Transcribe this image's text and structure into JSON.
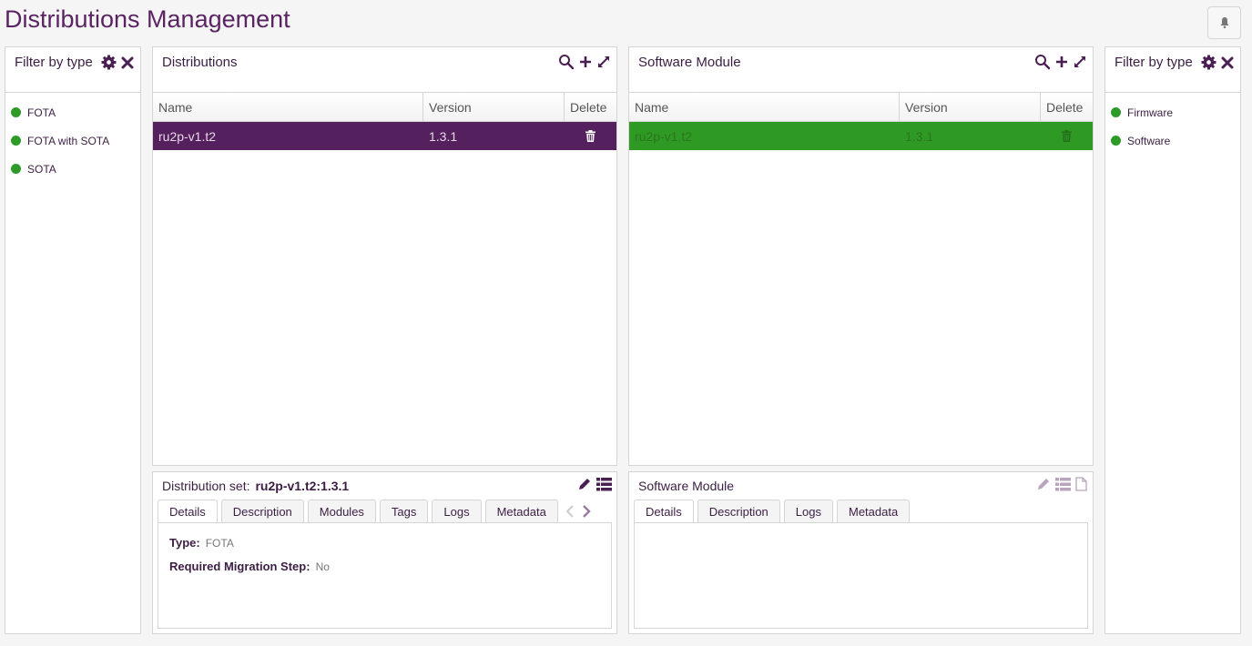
{
  "page": {
    "title": "Distributions Management"
  },
  "colors": {
    "brand": "#5a2463",
    "selected_dist": "#54205d",
    "selected_sw": "#2e9a23",
    "status_dot": "#2e9a28"
  },
  "left_filter": {
    "title": "Filter by type",
    "items": [
      {
        "label": "FOTA"
      },
      {
        "label": "FOTA with SOTA"
      },
      {
        "label": "SOTA"
      }
    ]
  },
  "distributions": {
    "title": "Distributions",
    "columns": {
      "name": "Name",
      "version": "Version",
      "delete": "Delete"
    },
    "rows": [
      {
        "name": "ru2p-v1.t2",
        "version": "1.3.1"
      }
    ]
  },
  "software_module": {
    "title": "Software Module",
    "columns": {
      "name": "Name",
      "version": "Version",
      "delete": "Delete"
    },
    "rows": [
      {
        "name": "ru2p-v1.t2",
        "version": "1.3.1"
      }
    ]
  },
  "right_filter": {
    "title": "Filter by type",
    "items": [
      {
        "label": "Firmware"
      },
      {
        "label": "Software"
      }
    ]
  },
  "dist_details": {
    "label": "Distribution set:",
    "value": "ru2p-v1.t2:1.3.1",
    "tabs": [
      "Details",
      "Description",
      "Modules",
      "Tags",
      "Logs",
      "Metadata"
    ],
    "fields": [
      {
        "key": "Type:",
        "value": "FOTA"
      },
      {
        "key": "Required Migration Step:",
        "value": "No"
      }
    ]
  },
  "sw_details": {
    "label": "Software Module",
    "tabs": [
      "Details",
      "Description",
      "Logs",
      "Metadata"
    ]
  }
}
